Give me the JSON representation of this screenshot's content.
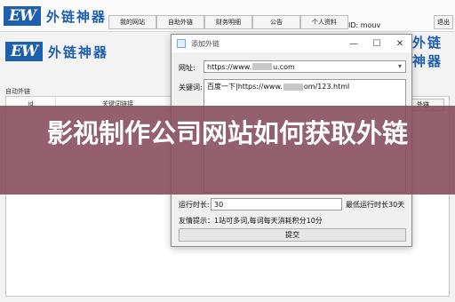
{
  "app": {
    "logo_mark": "EW",
    "logo_text": "外链神器",
    "tabs": [
      "我的网站",
      "自助外链",
      "财务明细",
      "公告",
      "个人资料"
    ],
    "user_id": "ID: mouv",
    "exit_label": "退出",
    "section_label": "自动外链",
    "grid_columns": [
      "id",
      "关键词链接"
    ],
    "right_button_label": "外链"
  },
  "dialog": {
    "title": "添加外链",
    "controls": [
      "—",
      "☐",
      "✕"
    ],
    "url_label": "网址:",
    "url_value_start": "https://www.",
    "url_value_end": "u.com",
    "keyword_label": "关键词:",
    "keyword_value_start": "百度一下|https://www.",
    "keyword_value_end": "om/123.html",
    "run_label": "运行时长:",
    "run_value": "30",
    "min_run_label": "最低运行时长30天",
    "tip": "友情提示：1站可多词,每词每天消耗积分10分",
    "submit_label": "提交"
  },
  "overlay": {
    "title": "影视制作公司网站如何获取外链"
  }
}
